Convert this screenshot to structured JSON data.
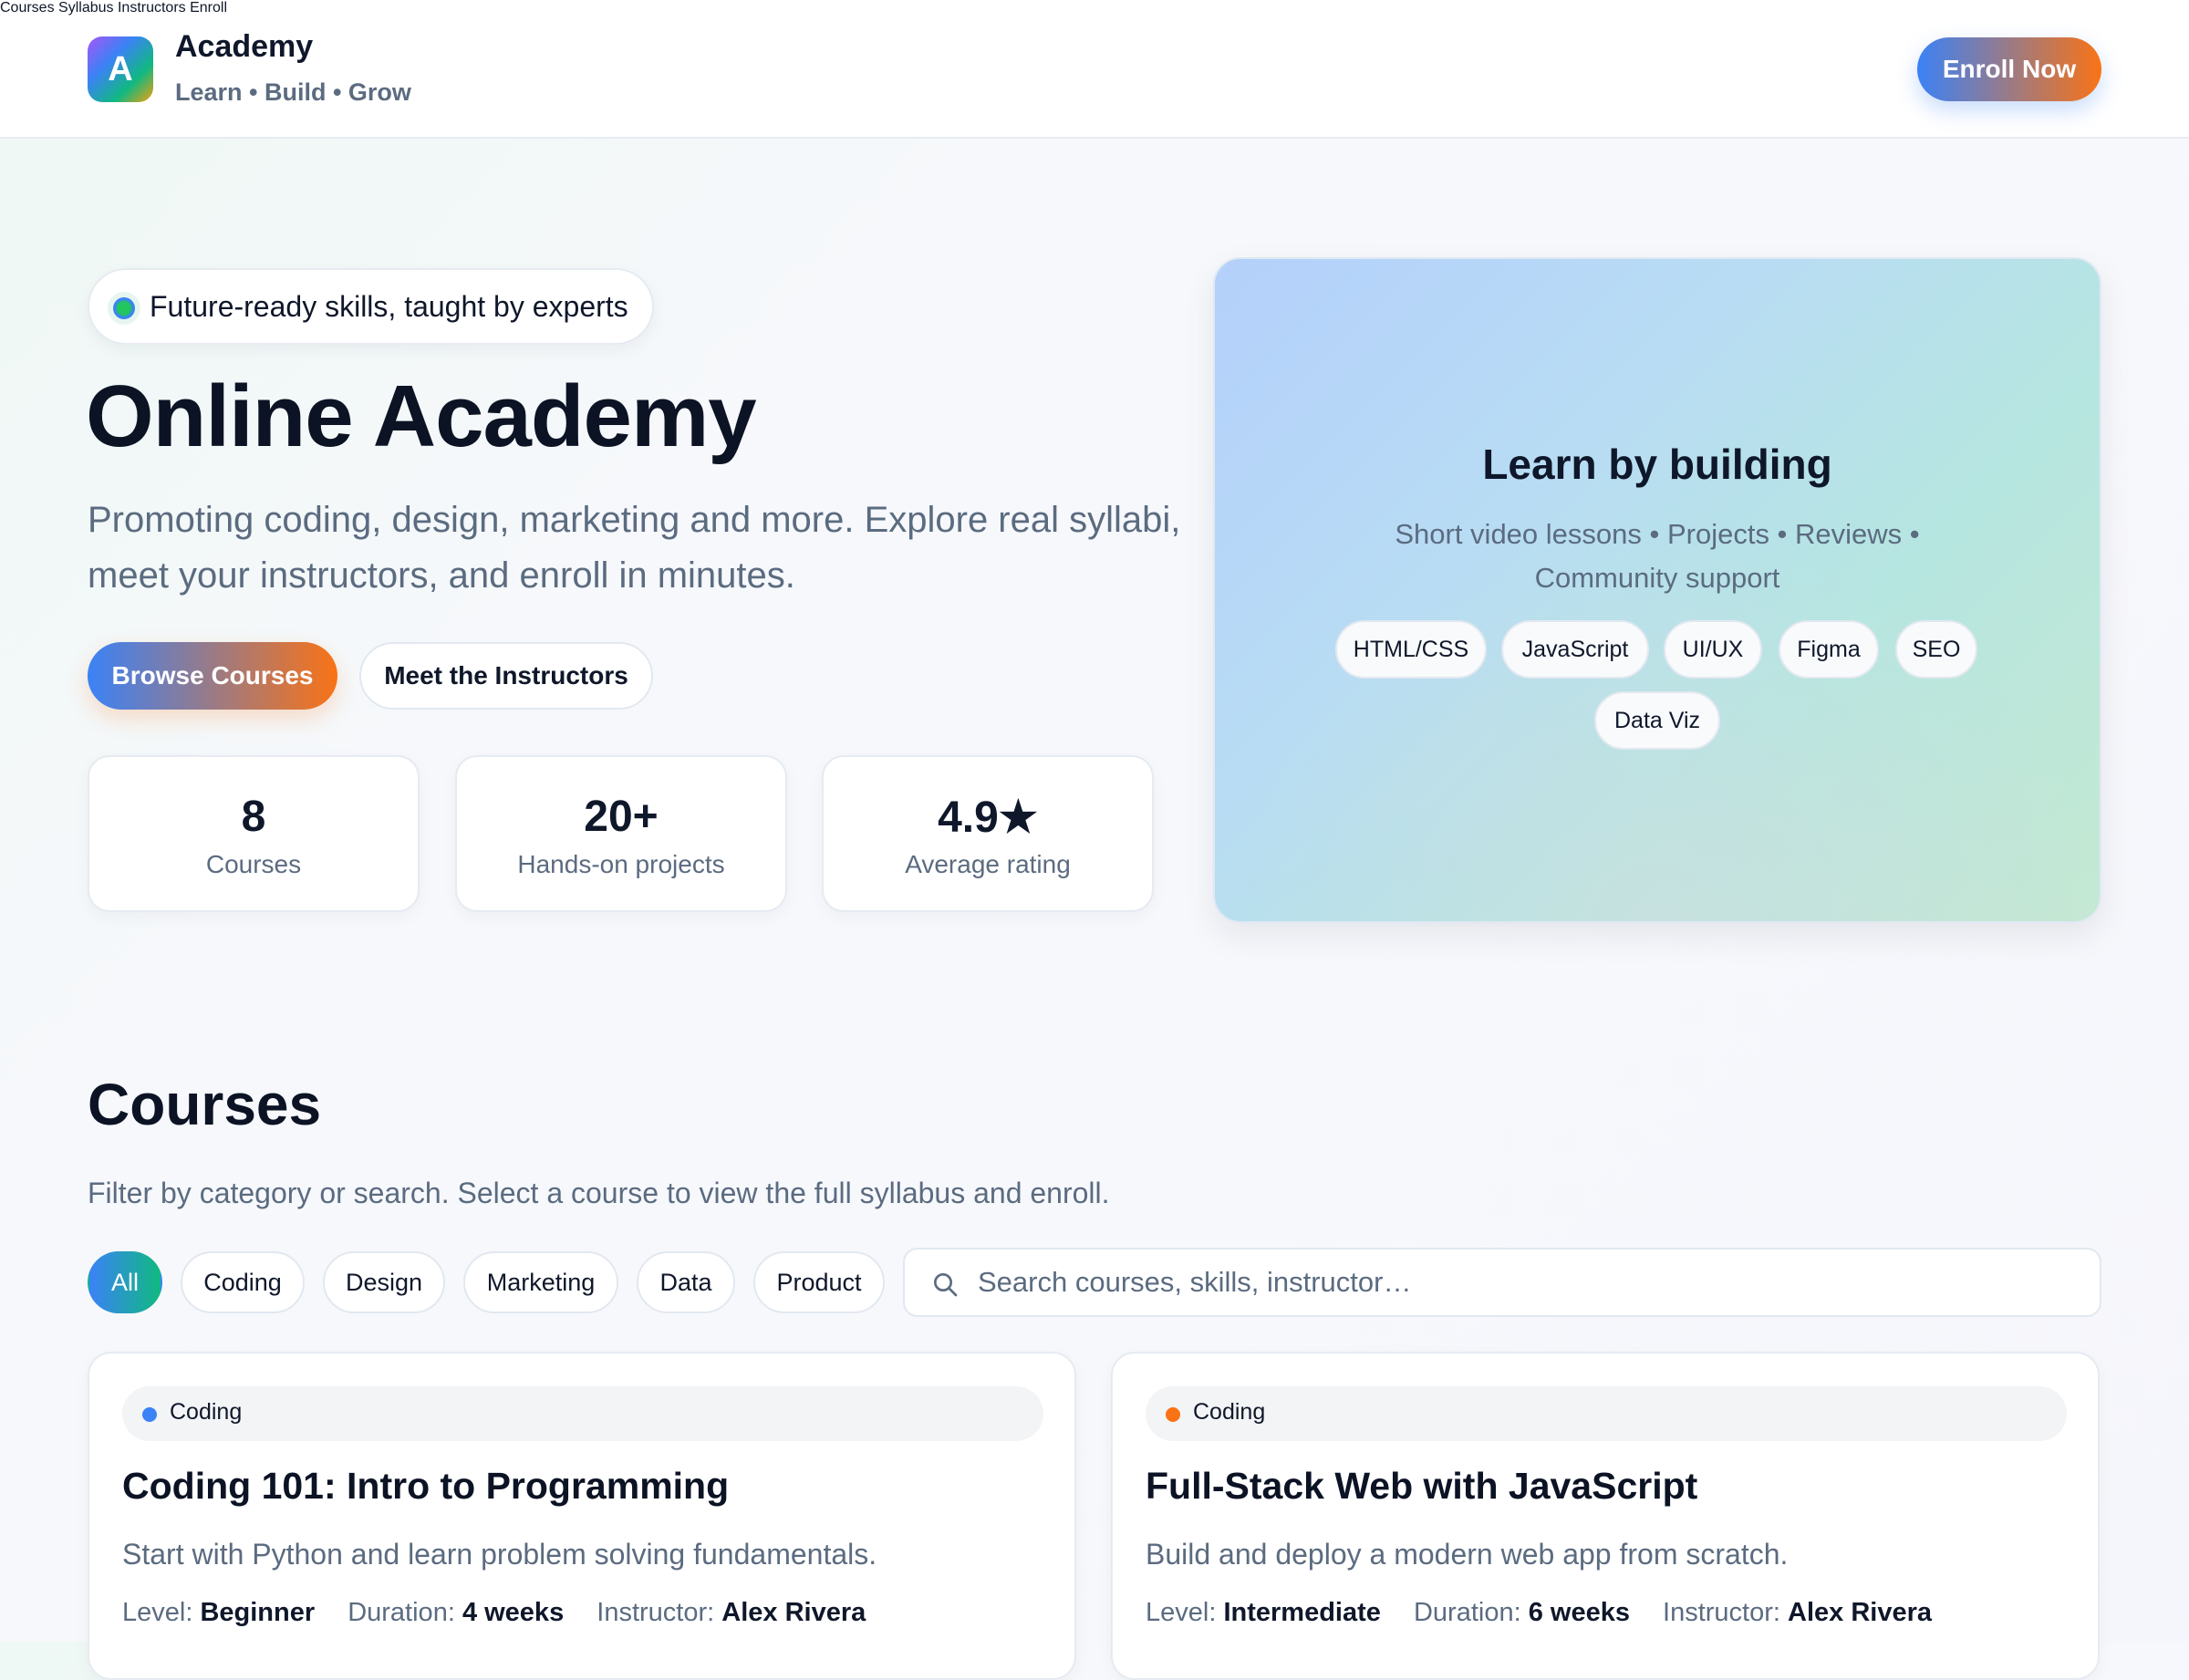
{
  "brand": {
    "logo_letter": "A",
    "name": "Academy",
    "tagline": "Learn • Build • Grow"
  },
  "nav": {
    "items": [
      "Courses",
      "Syllabus",
      "Instructors",
      "Enroll"
    ],
    "cta": "Enroll Now"
  },
  "hero": {
    "pill": "Future-ready skills, taught by experts",
    "title": "Online Academy",
    "description": "Promoting coding, design, marketing and more. Explore real syllabi, meet your instructors, and enroll in minutes.",
    "primary_button": "Browse Courses",
    "secondary_button": "Meet the Instructors",
    "stats": [
      {
        "value": "8",
        "label": "Courses"
      },
      {
        "value": "20+",
        "label": "Hands-on projects"
      },
      {
        "value": "4.9★",
        "label": "Average rating"
      }
    ],
    "card": {
      "title": "Learn by building",
      "subtitle": "Short video lessons • Projects • Reviews • Community support",
      "chips": [
        "HTML/CSS",
        "JavaScript",
        "UI/UX",
        "Figma",
        "SEO",
        "Data Viz"
      ]
    }
  },
  "courses_section": {
    "title": "Courses",
    "description": "Filter by category or search. Select a course to view the full syllabus and enroll.",
    "filters": [
      "All",
      "Coding",
      "Design",
      "Marketing",
      "Data",
      "Product"
    ],
    "active_filter": "All",
    "search": {
      "placeholder": "Search courses, skills, instructor…",
      "value": ""
    },
    "meta_labels": {
      "level": "Level:",
      "duration": "Duration:",
      "instructor": "Instructor:"
    },
    "courses": [
      {
        "category": "Coding",
        "dot_color": "#3b82f6",
        "title": "Coding 101: Intro to Programming",
        "description": "Start with Python and learn problem solving fundamentals.",
        "level": "Beginner",
        "duration": "4 weeks",
        "instructor": "Alex Rivera"
      },
      {
        "category": "Coding",
        "dot_color": "#f97316",
        "title": "Full-Stack Web with JavaScript",
        "description": "Build and deploy a modern web app from scratch.",
        "level": "Intermediate",
        "duration": "6 weeks",
        "instructor": "Alex Rivera"
      }
    ]
  },
  "colors": {
    "brand_start": "#3b82f6",
    "brand_end": "#f97316",
    "accent_green": "#10b981",
    "text_muted": "#5b6b80"
  },
  "icons": {
    "search": "search-icon",
    "star": "star"
  }
}
